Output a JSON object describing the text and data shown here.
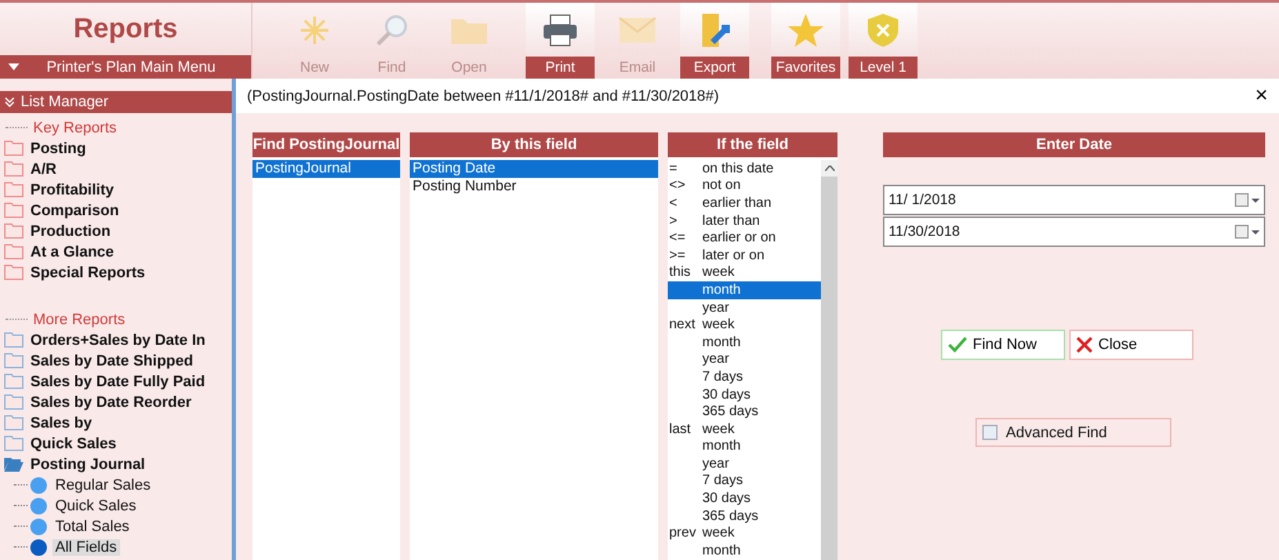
{
  "ribbon": {
    "title": "Reports",
    "main_menu": "Printer's Plan Main Menu",
    "tools": [
      {
        "kind": "new",
        "label": "New",
        "disabled": true
      },
      {
        "kind": "find",
        "label": "Find",
        "disabled": true
      },
      {
        "kind": "open",
        "label": "Open",
        "disabled": true
      },
      {
        "kind": "print",
        "label": "Print",
        "disabled": false
      },
      {
        "kind": "email",
        "label": "Email",
        "disabled": true
      },
      {
        "kind": "export",
        "label": "Export",
        "disabled": false
      },
      {
        "kind": "favorites",
        "label": "Favorites",
        "disabled": false
      },
      {
        "kind": "level",
        "label": "Level 1",
        "disabled": false
      }
    ]
  },
  "sidebar": {
    "title": "List Manager",
    "sections": [
      {
        "title": "Key Reports",
        "items": [
          {
            "label": "Posting",
            "color": "#f08c8c",
            "expanded": false
          },
          {
            "label": "A/R",
            "color": "#f08c8c",
            "expanded": false
          },
          {
            "label": "Profitability",
            "color": "#f08c8c",
            "expanded": false
          },
          {
            "label": "Comparison",
            "color": "#f08c8c",
            "expanded": false
          },
          {
            "label": "Production",
            "color": "#f08c8c",
            "expanded": false
          },
          {
            "label": "At a Glance",
            "color": "#f08c8c",
            "expanded": false
          },
          {
            "label": "Special Reports",
            "color": "#f08c8c",
            "expanded": false
          }
        ]
      },
      {
        "title": "More Reports",
        "items": [
          {
            "label": "Orders+Sales by Date In",
            "color": "#8ab4dc",
            "expanded": false
          },
          {
            "label": "Sales by Date Shipped",
            "color": "#8ab4dc",
            "expanded": false
          },
          {
            "label": "Sales by Date Fully Paid",
            "color": "#8ab4dc",
            "expanded": false
          },
          {
            "label": "Sales by Date Reorder",
            "color": "#8ab4dc",
            "expanded": false
          },
          {
            "label": "Sales by",
            "color": "#8ab4dc",
            "expanded": false
          },
          {
            "label": "Quick Sales",
            "color": "#8ab4dc",
            "expanded": false
          },
          {
            "label": "Posting Journal",
            "color": "#3a7fc0",
            "expanded": true,
            "children": [
              {
                "label": "Regular Sales",
                "selected": false
              },
              {
                "label": "Quick Sales",
                "selected": false
              },
              {
                "label": "Total Sales",
                "selected": false
              },
              {
                "label": "All Fields",
                "selected": true
              }
            ]
          }
        ]
      }
    ]
  },
  "dialog": {
    "title": "(PostingJournal.PostingDate between #11/1/2018# and #11/30/2018#)",
    "close": "×",
    "find": {
      "header": "Find PostingJournal",
      "items": [
        {
          "label": "PostingJournal",
          "selected": true
        }
      ]
    },
    "field": {
      "header": "By this field",
      "items": [
        {
          "label": "Posting Date",
          "selected": true
        },
        {
          "label": "Posting Number",
          "selected": false
        }
      ]
    },
    "condition": {
      "header": "If the field",
      "items": [
        {
          "prefix": "=",
          "label": "on this date",
          "selected": false
        },
        {
          "prefix": "<>",
          "label": "not on",
          "selected": false
        },
        {
          "prefix": "<",
          "label": "earlier than",
          "selected": false
        },
        {
          "prefix": ">",
          "label": "later than",
          "selected": false
        },
        {
          "prefix": "<=",
          "label": "earlier or on",
          "selected": false
        },
        {
          "prefix": ">=",
          "label": "later or on",
          "selected": false
        },
        {
          "prefix": "this",
          "label": "week",
          "selected": false
        },
        {
          "label": "month",
          "selected": true
        },
        {
          "label": "year",
          "selected": false
        },
        {
          "prefix": "next",
          "label": "week",
          "selected": false
        },
        {
          "label": "month",
          "selected": false
        },
        {
          "label": "year",
          "selected": false
        },
        {
          "label": "7 days",
          "selected": false
        },
        {
          "label": "30 days",
          "selected": false
        },
        {
          "label": "365 days",
          "selected": false
        },
        {
          "prefix": "last",
          "label": "week",
          "selected": false
        },
        {
          "label": "month",
          "selected": false
        },
        {
          "label": "year",
          "selected": false
        },
        {
          "label": "7 days",
          "selected": false
        },
        {
          "label": "30 days",
          "selected": false
        },
        {
          "label": "365 days",
          "selected": false
        },
        {
          "prefix": "prev",
          "label": "week",
          "selected": false
        },
        {
          "label": "month",
          "selected": false
        }
      ]
    },
    "date": {
      "header": "Enter Date",
      "from": "11/  1/2018",
      "to": "11/30/2018"
    },
    "buttons": [
      {
        "kind": "find",
        "label": "Find Now"
      },
      {
        "kind": "close",
        "label": "Close"
      }
    ],
    "advanced": {
      "label": "Advanced Find",
      "checked": false
    }
  }
}
